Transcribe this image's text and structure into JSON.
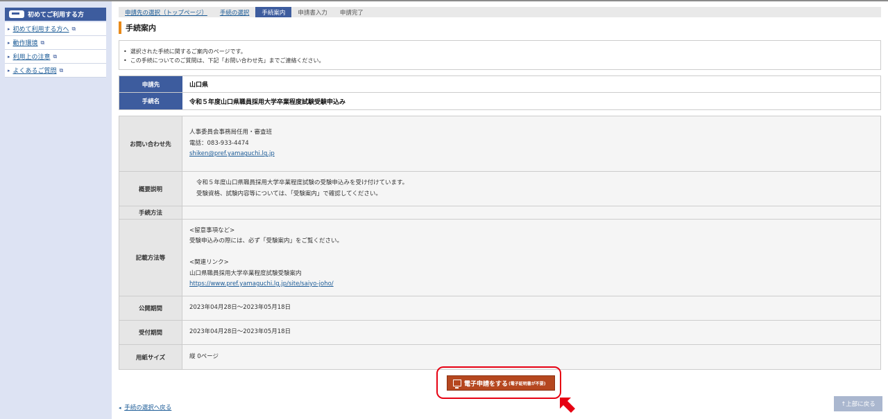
{
  "sidebar": {
    "header": "初めてご利用する方",
    "items": [
      {
        "label": "初めて利用する方へ"
      },
      {
        "label": "動作環境"
      },
      {
        "label": "利用上の注意"
      },
      {
        "label": "よくあるご質問"
      }
    ]
  },
  "breadcrumb": [
    {
      "label": "申請先の選択（トップページ）",
      "state": "link"
    },
    {
      "label": "手続の選択",
      "state": "link"
    },
    {
      "label": "手続案内",
      "state": "active"
    },
    {
      "label": "申請書入力",
      "state": "pending"
    },
    {
      "label": "申請完了",
      "state": "pending"
    }
  ],
  "page_title": "手続案内",
  "notices": [
    "選択された手続に関するご案内のページです。",
    "この手続についてのご質問は、下記「お問い合わせ先」までご連絡ください。"
  ],
  "info": {
    "applicant_label": "申請先",
    "applicant_value": "山口県",
    "procedure_label": "手続名",
    "procedure_value": "令和５年度山口県職員採用大学卒業程度試験受験申込み"
  },
  "detail": {
    "contact_label": "お問い合わせ先",
    "contact_dept": "人事委員会事務局任用・審査班",
    "contact_phone": "電話：083-933-4474",
    "contact_email": "shiken@pref.yamaguchi.lg.jp",
    "summary_label": "概要説明",
    "summary_line1": "令和５年度山口県職員採用大学卒業程度試験の受験申込みを受け付けています。",
    "summary_line2": "受験資格、試験内容等については、「受験案内」で確認してください。",
    "method_label": "手続方法",
    "method_value": "",
    "notes_label": "記載方法等",
    "notes_line1": "<留意事項など>",
    "notes_line2": "受験申込みの際には、必ず「受験案内」をご覧ください。",
    "notes_line3": "<関連リンク>",
    "notes_line4": "山口県職員採用大学卒業程度試験受験案内",
    "notes_link": "https://www.pref.yamaguchi.lg.jp/site/saiyo-joho/",
    "public_label": "公開期間",
    "public_value": "2023年04月28日～2023年05月18日",
    "accept_label": "受付期間",
    "accept_value": "2023年04月28日～2023年05月18日",
    "paper_label": "用紙サイズ",
    "paper_value": "縦 0ページ"
  },
  "submit": {
    "label": "電子申請をする",
    "sublabel": "(電子証明書が不要)"
  },
  "back_link": "手続の選択へ戻る",
  "top_button": "↑上部に戻る",
  "colors": {
    "primary": "#3d5c9e",
    "accent": "#e88a1a",
    "submit": "#b5471f",
    "highlight": "#e60012"
  }
}
